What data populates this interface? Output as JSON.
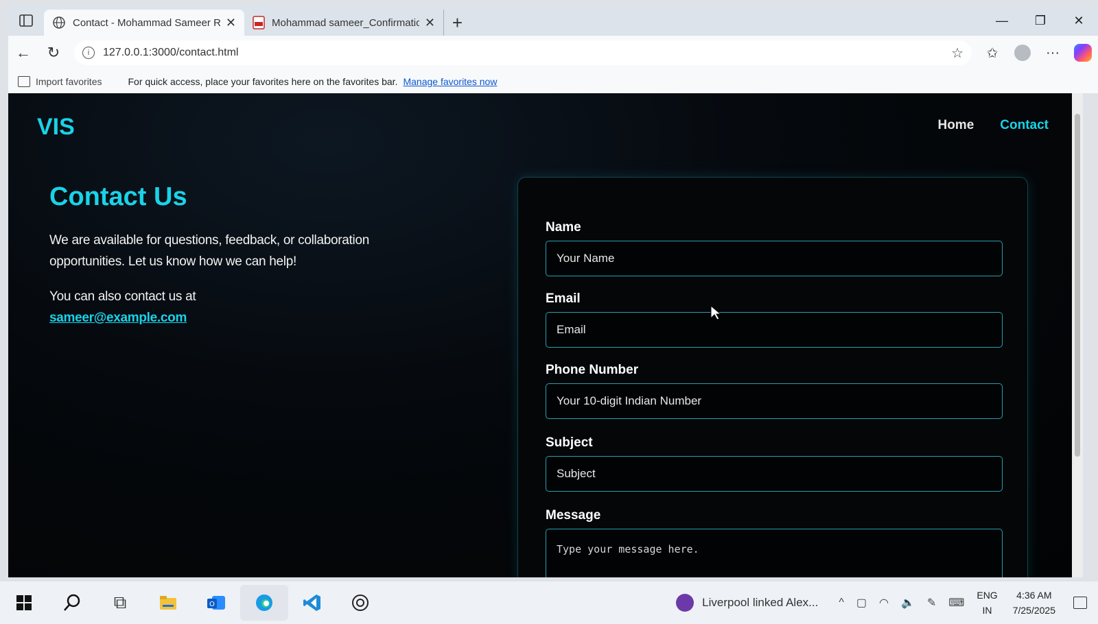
{
  "browser": {
    "tabs": [
      {
        "title": "Contact - Mohammad Sameer Ra",
        "icon": "globe-icon",
        "active": true
      },
      {
        "title": "Mohammad sameer_Confirmatio",
        "icon": "pdf-icon",
        "active": false
      }
    ],
    "new_tab": "+",
    "window_controls": {
      "minimize": "—",
      "restore": "❐",
      "close": "✕"
    },
    "url": "127.0.0.1:3000/contact.html",
    "favorites_bar": {
      "import_label": "Import favorites",
      "message": "For quick access, place your favorites here on the favorites bar.",
      "link": "Manage favorites now"
    }
  },
  "site": {
    "brand": "VIS",
    "nav": {
      "home": "Home",
      "contact": "Contact"
    },
    "heading": "Contact Us",
    "intro": "We are available for questions, feedback, or collaboration opportunities. Let us know how we can help!",
    "also_contact": "You can also contact us at",
    "email": "sameer@example.com",
    "form": {
      "name_label": "Name",
      "name_placeholder": "Your Name",
      "email_label": "Email",
      "email_placeholder": "Email",
      "phone_label": "Phone Number",
      "phone_placeholder": "Your 10-digit Indian Number",
      "subject_label": "Subject",
      "subject_placeholder": "Subject",
      "message_label": "Message",
      "message_placeholder": "Type your message here."
    }
  },
  "taskbar": {
    "news": "Liverpool linked Alex...",
    "lang_top": "ENG",
    "lang_bottom": "IN",
    "time": "4:36 AM",
    "date": "7/25/2025"
  },
  "colors": {
    "accent": "#19d3e8",
    "page_bg": "#020304"
  }
}
